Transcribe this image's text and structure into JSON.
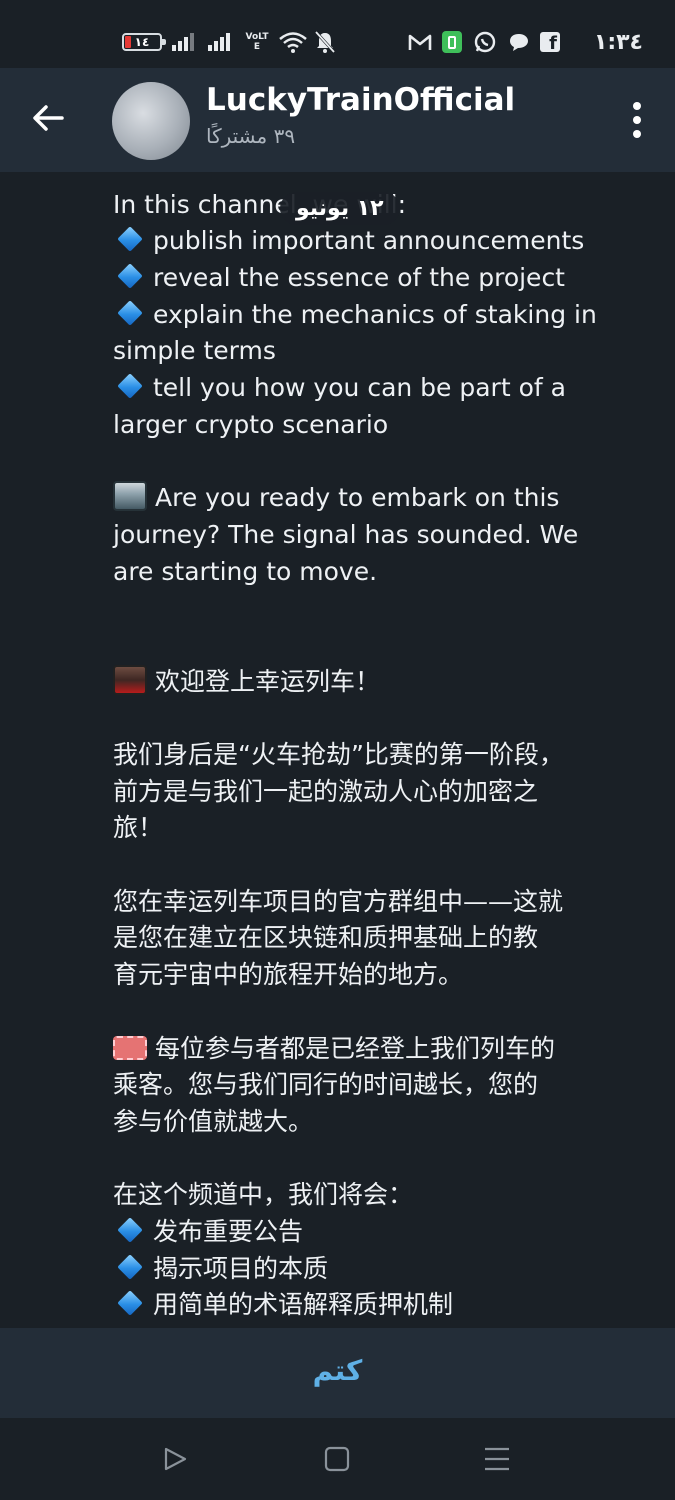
{
  "status_bar": {
    "battery": "١٤",
    "network_label": "VoLTE",
    "time": "١:٣٤",
    "icons": [
      "battery-icon",
      "signal-icon",
      "signal-icon",
      "volte-icon",
      "wifi-icon",
      "mute-icon",
      "gmail-icon",
      "battery-saver-icon",
      "whatsapp-icon",
      "chat-icon",
      "facebook-icon"
    ]
  },
  "header": {
    "title": "LuckyTrainOfficial",
    "subtitle": "٣٩ مشتركًا"
  },
  "date_pill": "١٢ يونيو",
  "message": {
    "en_intro": "In this channel, we will:",
    "en_bullets": [
      "publish important announcements",
      "reveal the essence of the project",
      "explain the mechanics of staking in",
      "tell you how you can be part of a"
    ],
    "en_wrap": [
      "simple terms",
      "larger crypto scenario"
    ],
    "en_journey": [
      "Are you ready to embark on this",
      "journey? The signal has sounded. We",
      "are starting to move."
    ],
    "zh_welcome": "欢迎登上幸运列车！",
    "zh_p1": [
      "我们身后是“火车抢劫”比赛的第一阶段，",
      "前方是与我们一起的激动人心的加密之",
      "旅！"
    ],
    "zh_p2": [
      "您在幸运列车项目的官方群组中——这就",
      "是您在建立在区块链和质押基础上的教",
      "育元宇宙中的旅程开始的地方。"
    ],
    "zh_p3": [
      "每位参与者都是已经登上我们列车的",
      "乘客。您与我们同行的时间越长，您的",
      "参与价值就越大。"
    ],
    "zh_intro": "在这个频道中，我们将会：",
    "zh_bullets": [
      "发布重要公告",
      "揭示项目的本质",
      "用简单的术语解释质押机制"
    ]
  },
  "bottom": {
    "mute_label": "كتم"
  }
}
